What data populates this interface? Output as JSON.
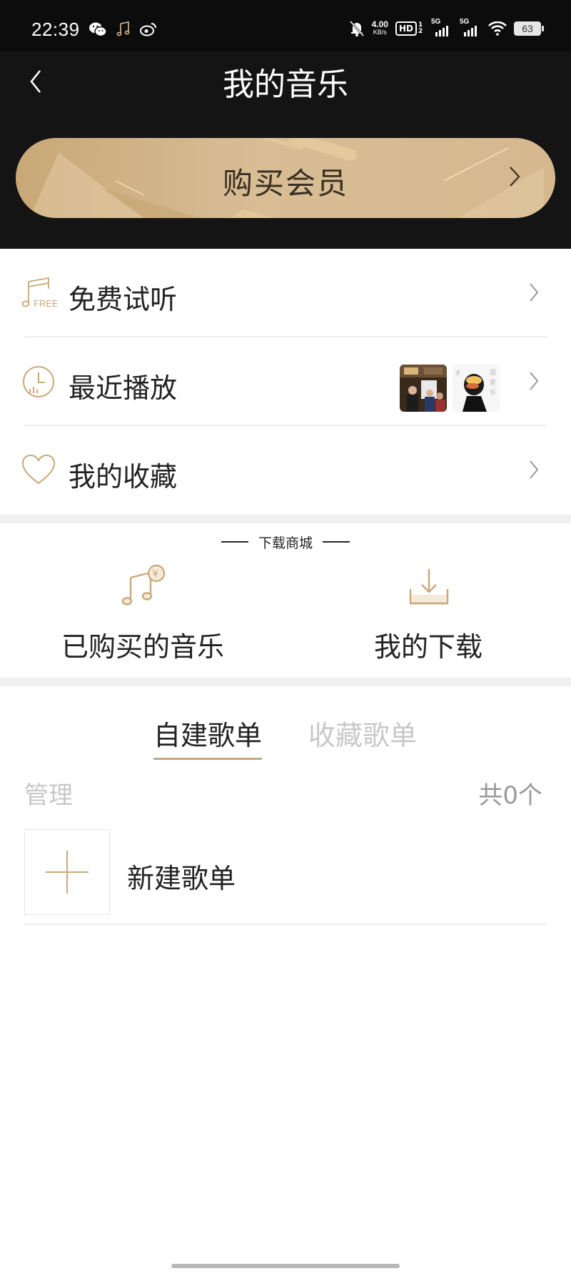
{
  "status_bar": {
    "time": "22:39",
    "net_speed_value": "4.00",
    "net_speed_unit": "KB/s",
    "hd_label": "HD",
    "hd_sub": "1 2",
    "signal1_label": "5G",
    "signal2_label": "5G",
    "battery": "63",
    "icons": [
      "wechat-icon",
      "music-note-icon",
      "weibo-icon",
      "bell-muted-icon",
      "wifi-icon"
    ]
  },
  "header": {
    "title": "我的音乐",
    "back_icon": "chevron-left-icon"
  },
  "vip_banner": {
    "label": "购买会员"
  },
  "menu": [
    {
      "label": "免费试听",
      "icon": "music-free-icon"
    },
    {
      "label": "最近播放",
      "icon": "clock-icon"
    },
    {
      "label": "我的收藏",
      "icon": "heart-icon"
    }
  ],
  "download_section": {
    "title": "下载商城",
    "items": [
      {
        "label": "已购买的音乐",
        "icon": "purchased-music-icon"
      },
      {
        "label": "我的下载",
        "icon": "download-icon"
      }
    ]
  },
  "tabs": {
    "active": "自建歌单",
    "inactive": "收藏歌单"
  },
  "playlist": {
    "manage": "管理",
    "count": "共0个",
    "new_label": "新建歌单"
  },
  "colors": {
    "gold": "#c9a878",
    "dark_bg": "#141414",
    "muted": "#c8c8c8"
  }
}
